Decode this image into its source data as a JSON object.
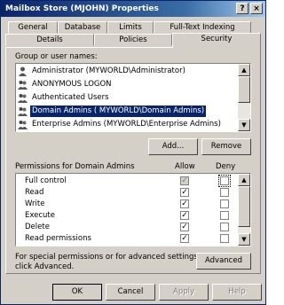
{
  "window": {
    "title": "Mailbox Store (MJOHN) Properties",
    "help_glyph": "?",
    "close_glyph": "×"
  },
  "tabs_top": [
    "General",
    "Database",
    "Limits",
    "Full-Text Indexing"
  ],
  "tabs_bottom": [
    "Details",
    "Policies",
    "Security"
  ],
  "active_tab": "Security",
  "group_label": "Group or user names:",
  "users": [
    {
      "name": "Administrator (MYWORLD\\Administrator)",
      "icon": "user-icon",
      "selected": false
    },
    {
      "name": "ANONYMOUS LOGON",
      "icon": "group-icon",
      "selected": false
    },
    {
      "name": "Authenticated Users",
      "icon": "group-icon",
      "selected": false
    },
    {
      "name": "Domain Admins ( MYWORLD\\Domain Admins)",
      "icon": "group-icon",
      "selected": true
    },
    {
      "name": "Enterprise Admins (MYWORLD\\Enterprise Admins)",
      "icon": "group-icon",
      "selected": false
    }
  ],
  "buttons": {
    "add": "Add...",
    "remove": "Remove",
    "advanced": "Advanced",
    "ok": "OK",
    "cancel": "Cancel",
    "apply": "Apply",
    "help": "Help"
  },
  "permissions_label": "Permissions for Domain Admins",
  "allow_label": "Allow",
  "deny_label": "Deny",
  "permissions": [
    {
      "name": "Full control",
      "allow": true,
      "allow_inherited": true,
      "deny": false
    },
    {
      "name": "Read",
      "allow": true,
      "allow_inherited": false,
      "deny": false
    },
    {
      "name": "Write",
      "allow": true,
      "allow_inherited": false,
      "deny": false
    },
    {
      "name": "Execute",
      "allow": true,
      "allow_inherited": false,
      "deny": false
    },
    {
      "name": "Delete",
      "allow": true,
      "allow_inherited": false,
      "deny": false
    },
    {
      "name": "Read permissions",
      "allow": true,
      "allow_inherited": false,
      "deny": false
    }
  ],
  "special_text_line1": "For special permissions or for advanced settings,",
  "special_text_line2": "click Advanced.",
  "check_glyph": "✓",
  "scroll_up_glyph": "▲",
  "scroll_down_glyph": "▼"
}
